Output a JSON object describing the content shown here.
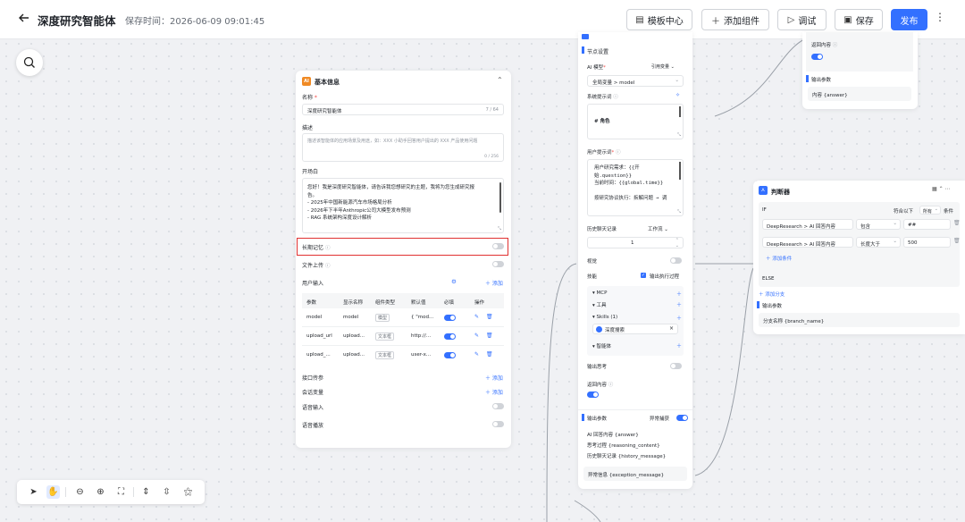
{
  "header": {
    "title": "深度研究智能体",
    "save_time": "保存时间：2026-06-09 09:01:45",
    "template_center": "模板中心",
    "add_component": "添加组件",
    "debug": "调试",
    "save": "保存",
    "publish": "发布"
  },
  "basic": {
    "title": "基本信息",
    "name_label": "名称",
    "name_value": "深度研究智能体",
    "name_count": "7 / 64",
    "desc_label": "描述",
    "desc_placeholder": "描述该智能体的应用场景及用途，如：XXX 小助手回答用户提出的 XXX 产品使用问题",
    "desc_count": "0 / 256",
    "opening_label": "开场白",
    "opening_lines": [
      "您好！我是深度研究智能体，请告诉我您想研究的主题，我将为您生成研究报",
      "告。",
      "- 2025年中国新能源汽车市场格局分析",
      "- 2026年下半年Anthropic公司大模型发布预测",
      "- RAG 系统架构深度设计解析"
    ],
    "long_memory": "长期记忆",
    "file_upload": "文件上传",
    "user_input": "用户输入",
    "add": "添加",
    "table_headers": [
      "参数",
      "显示名称",
      "组件类型",
      "默认值",
      "必填",
      "操作"
    ],
    "rows": [
      {
        "param": "model",
        "display": "model",
        "type": "模型",
        "default": "{ \"mod..."
      },
      {
        "param": "upload_url",
        "display": "upload...",
        "type": "文本框",
        "default": "http://..."
      },
      {
        "param": "upload_...",
        "display": "upload...",
        "type": "文本框",
        "default": "user-x..."
      }
    ],
    "interface_params": "接口传参",
    "session_vars": "会话变量",
    "voice_input": "语音输入",
    "voice_play": "语音播放"
  },
  "ai": {
    "node_settings": "节点设置",
    "ai_model_label": "AI 模型",
    "ref_var": "引用变量",
    "model_value": "全局变量 > model",
    "sys_prompt_label": "系统提示词",
    "sys_prompt_text": "# 角色",
    "user_prompt_label": "用户提示词",
    "user_prompt_lines": [
      "用户研究需求：{{开",
      "始.question}}",
      "当前时间：{{global.time}}",
      "",
      "按研究协议执行：拆解问题 → 调"
    ],
    "history_label": "历史聊天记录",
    "workflow": "工作流",
    "history_value": "1",
    "vision": "视觉",
    "skills": "技能",
    "show_process": "输出执行过程",
    "mcp": "MCP",
    "tools": "工具",
    "skills_count": "Skills (1)",
    "deep_search": "深度搜索",
    "agents": "智能体",
    "output_thinking": "输出思考",
    "return_content": "返回内容",
    "output_params": "输出参数",
    "exception_capture": "异常捕获",
    "outputs": [
      "AI 回答内容 {answer}",
      "思考过程 {reasoning_content}",
      "历史聊天记录 {history_message}"
    ],
    "exception_msg": "异常信息 {exception_message}"
  },
  "topright": {
    "return_content": "返回内容",
    "output_params": "输出参数",
    "output_value": "内容 {answer}"
  },
  "judge": {
    "title": "判断器",
    "if_label": "IF",
    "match_label": "符合以下",
    "match_value": "所有",
    "condition": "条件",
    "cond1_field": "DeepResearch > AI 回答内容",
    "cond1_op": "包含",
    "cond1_val": "##",
    "cond2_field": "DeepResearch > AI 回答内容",
    "cond2_op": "长度大于",
    "cond2_val": "500",
    "add_condition": "添加条件",
    "else_label": "ELSE",
    "add_branch": "添加分支",
    "output_params": "输出参数",
    "branch_name": "分支名称 {branch_name}"
  }
}
